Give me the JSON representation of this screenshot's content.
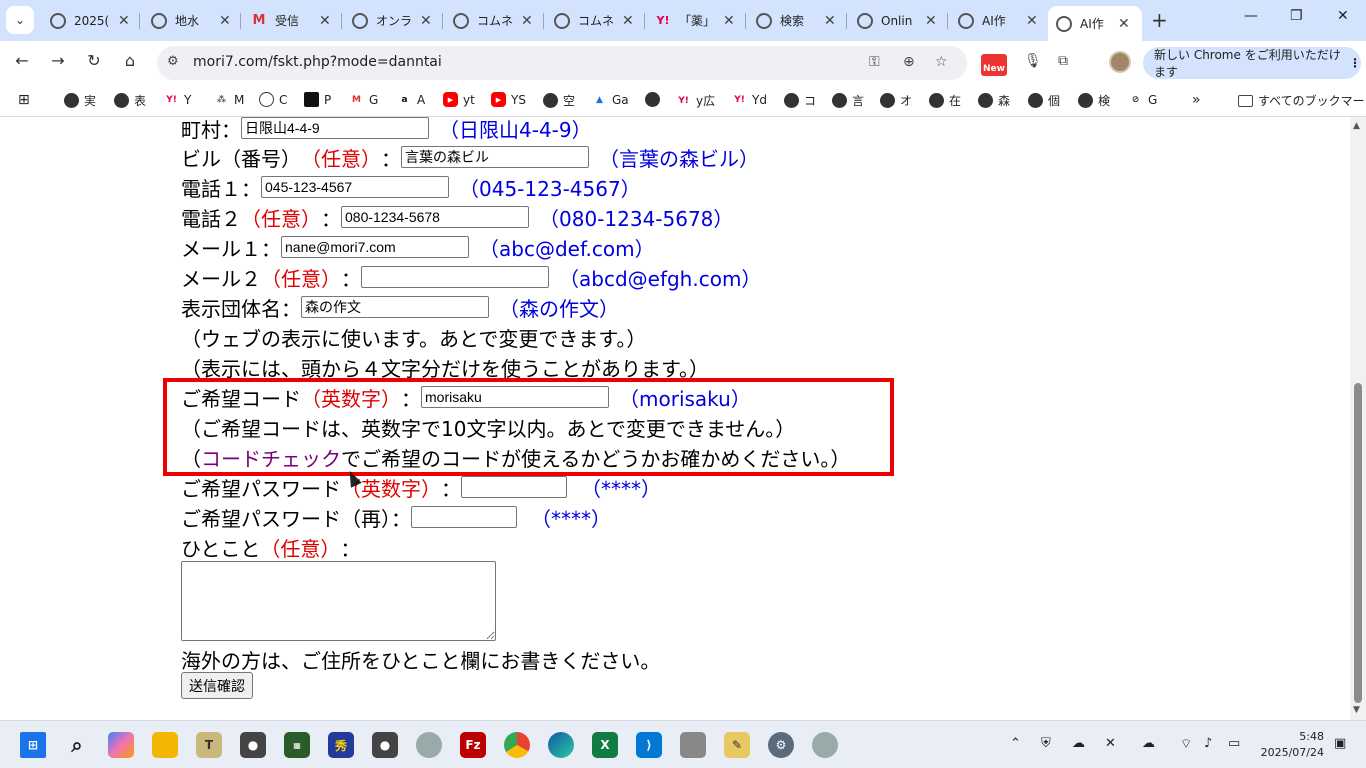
{
  "browser": {
    "tabs": [
      {
        "title": "2025(",
        "favicon": "globe"
      },
      {
        "title": "地水",
        "favicon": "globe"
      },
      {
        "title": "受信",
        "favicon": "gmail"
      },
      {
        "title": "オンラ",
        "favicon": "globe"
      },
      {
        "title": "コムネ",
        "favicon": "globe"
      },
      {
        "title": "コムネ",
        "favicon": "globe"
      },
      {
        "title": "「薬」",
        "favicon": "yahoo"
      },
      {
        "title": "検索",
        "favicon": "globe"
      },
      {
        "title": "Onlin",
        "favicon": "globe"
      },
      {
        "title": "AI作",
        "favicon": "globe"
      },
      {
        "title": "AI作",
        "favicon": "globe",
        "active": true
      }
    ],
    "url": "mori7.com/fskt.php?mode=danntai",
    "update_button": "新しい Chrome をご利用いただけます",
    "new_badge": "New",
    "bookmarks": [
      {
        "label": "実",
        "icon": "globe"
      },
      {
        "label": "表",
        "icon": "globe"
      },
      {
        "label": "Y",
        "icon": "yahoo"
      },
      {
        "label": "M",
        "icon": "m"
      },
      {
        "label": "C",
        "icon": "openai"
      },
      {
        "label": "P",
        "icon": "p"
      },
      {
        "label": "G",
        "icon": "gmail"
      },
      {
        "label": "A",
        "icon": "amazon"
      },
      {
        "label": "yt",
        "icon": "youtube"
      },
      {
        "label": "YS",
        "icon": "youtube"
      },
      {
        "label": "空",
        "icon": "globe"
      },
      {
        "label": "Ga",
        "icon": "drive"
      },
      {
        "label": "",
        "icon": "globe"
      },
      {
        "label": "y広",
        "icon": "yahoo"
      },
      {
        "label": "Yd",
        "icon": "yahoo"
      },
      {
        "label": "コ",
        "icon": "globe"
      },
      {
        "label": "言",
        "icon": "globe"
      },
      {
        "label": "オ",
        "icon": "globe"
      },
      {
        "label": "在",
        "icon": "globe"
      },
      {
        "label": "森",
        "icon": "globe"
      },
      {
        "label": "個",
        "icon": "globe"
      },
      {
        "label": "検",
        "icon": "globe"
      },
      {
        "label": "G",
        "icon": "slash"
      }
    ],
    "all_bookmarks": "すべてのブックマーク",
    "more_bookmarks": "»"
  },
  "form": {
    "town": {
      "label": "町村：",
      "value": "日限山4-4-9",
      "example": "（日限山4-4-9）"
    },
    "building": {
      "label": "ビル（番号）",
      "optional": "（任意）",
      "colon": "：",
      "value": "言葉の森ビル",
      "example": "（言葉の森ビル）"
    },
    "phone1": {
      "label": "電話１：",
      "value": "045-123-4567",
      "example": "（045-123-4567）"
    },
    "phone2": {
      "label": "電話２",
      "optional": "（任意）",
      "colon": "：",
      "value": "080-1234-5678",
      "example": "（080-1234-5678）"
    },
    "mail1": {
      "label": "メール１：",
      "value": "nane@mori7.com",
      "example": "（abc@def.com）"
    },
    "mail2": {
      "label": "メール２",
      "optional": "（任意）",
      "colon": "：",
      "value": "",
      "example": "（abcd@efgh.com）"
    },
    "display_name": {
      "label": "表示団体名：",
      "value": "森の作文",
      "example": "（森の作文）"
    },
    "display_note1": "（ウェブの表示に使います。あとで変更できます。）",
    "display_note2": "（表示には、頭から４文字分だけを使うことがあります。）",
    "code": {
      "label": "ご希望コード",
      "alnum": "（英数字）",
      "colon": "：",
      "value": "morisaku",
      "example": "（morisaku）"
    },
    "code_note1": "（ご希望コードは、英数字で10文字以内。あとで変更できません。）",
    "code_note2_pre": "（",
    "code_check_link": "コードチェック",
    "code_note2_post": "でご希望のコードが使えるかどうかお確かめください。）",
    "password": {
      "label": "ご希望パスワード",
      "alnum": "（英数字）",
      "colon": "：",
      "value": "",
      "example": "（****）"
    },
    "password2": {
      "label": "ご希望パスワード（再）：",
      "value": "",
      "example": "（****）"
    },
    "comment": {
      "label": "ひとこと",
      "optional": "（任意）",
      "colon": "：",
      "value": ""
    },
    "overseas_note": "海外の方は、ご住所をひとこと欄にお書きください。",
    "submit": "送信確認"
  },
  "taskbar": {
    "time": "5:48",
    "date": "2025/07/24"
  }
}
